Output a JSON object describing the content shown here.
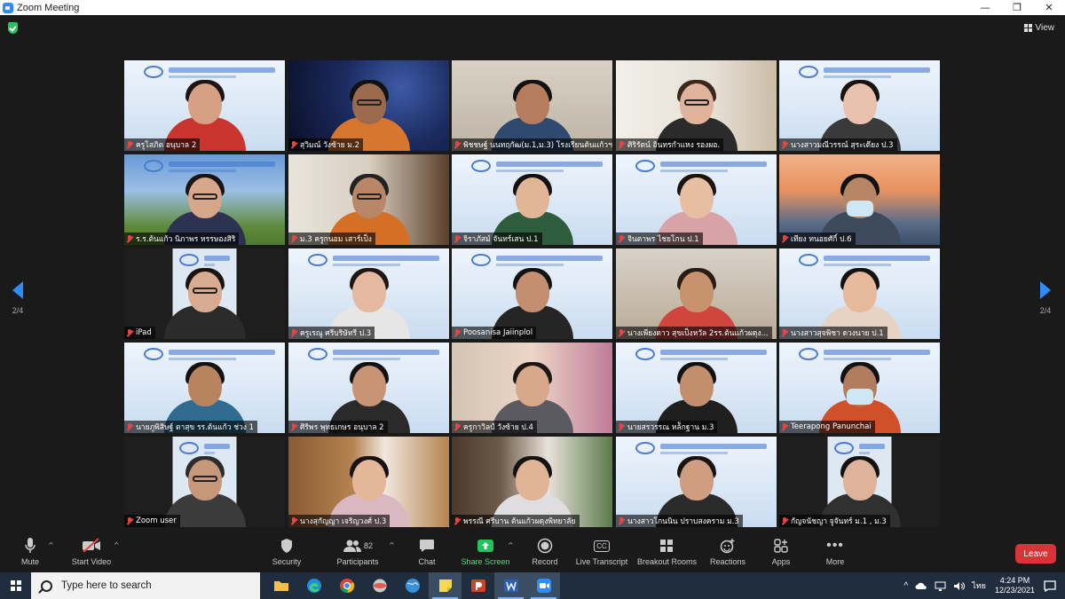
{
  "window": {
    "title": "Zoom Meeting",
    "controls": [
      "minimize",
      "restore",
      "close"
    ]
  },
  "top_right": {
    "view_label": "View"
  },
  "pagination": {
    "left": "2/4",
    "right": "2/4"
  },
  "participants": [
    {
      "name": "ครูโสภิต อนุบาล 2",
      "muted": true,
      "scene": "banner",
      "body": "#c8352f",
      "skin": "#d7a084",
      "hair": "#1b1411"
    },
    {
      "name": "สุวิมณ์ วังซ้าย ม.2",
      "muted": true,
      "scene": "space",
      "body": "#d7772f",
      "skin": "#9b6a4e",
      "hair": "#111",
      "glasses": true
    },
    {
      "name": "พิชชษฐ์ นนทฤกัฒ(ม.1,ม.3) โรงเรียนต้นแก้วฯ",
      "muted": true,
      "scene": "room",
      "body": "#2f4a6e",
      "skin": "#b57d5d",
      "hair": "#111"
    },
    {
      "name": "ศิริรัตน์ อินทรกำแหง รองผอ.",
      "muted": true,
      "scene": "shelf",
      "body": "#2b2b2b",
      "skin": "#e1b39a",
      "hair": "#3b281d",
      "glasses": true
    },
    {
      "name": "นางสาวมณีวรรณ์ สุระเดียง ป.3",
      "muted": true,
      "scene": "banner",
      "body": "#3a3a3a",
      "skin": "#e9c2ad",
      "hair": "#161210"
    },
    {
      "name": "ร.ร.ต้นแก้ว นิภาพร หรรษองสิริ",
      "muted": true,
      "scene": "school",
      "body": "#2c3350",
      "skin": "#d6a78a",
      "hair": "#1a1412",
      "glasses": true
    },
    {
      "name": "ม.3 ครูกนอม เสาร์เป็ง",
      "muted": true,
      "scene": "home",
      "body": "#d46f25",
      "skin": "#b88767",
      "hair": "#222",
      "glasses": true
    },
    {
      "name": "จิราภัสม์ จันทร์เสน ป.1",
      "muted": true,
      "scene": "banner",
      "body": "#2e5d3e",
      "skin": "#e0b697",
      "hair": "#111"
    },
    {
      "name": "จินตาพร ไชยโกน ป.1",
      "muted": true,
      "scene": "banner",
      "body": "#d7a3a7",
      "skin": "#e6bfa3",
      "hair": "#1a1411"
    },
    {
      "name": "เทียง ทนอยศักิ์ ป.6",
      "muted": true,
      "scene": "bridge",
      "body": "#3d4a5c",
      "skin": "#b58566",
      "hair": "#111",
      "mask": true
    },
    {
      "name": "iPad",
      "muted": true,
      "scene": "ipad",
      "body": "#2b2b2b",
      "skin": "#d9ab90",
      "hair": "#181311",
      "glasses": true
    },
    {
      "name": "ครูเรณู ศรีบริษัทรี ป.3",
      "muted": true,
      "scene": "banner",
      "body": "#e6e6e6",
      "skin": "#e4b99f",
      "hair": "#1d1512"
    },
    {
      "name": "Poosanisa Jaiinplol",
      "muted": true,
      "scene": "banner",
      "body": "#252525",
      "skin": "#c48f70",
      "hair": "#111"
    },
    {
      "name": "นางเพียงดาว สุขเป็งหวัล 2รร.ต้นแก้วผดุง...",
      "muted": true,
      "scene": "blur",
      "body": "#d0463e",
      "skin": "#c9926f",
      "hair": "#2a1c14"
    },
    {
      "name": "นางสาวสุจพิชา ดวงนาย ป.1",
      "muted": true,
      "scene": "banner",
      "body": "#e7d3c4",
      "skin": "#e6b99b",
      "hair": "#131010"
    },
    {
      "name": "นายภูพิสิษฐ์ ตาสุข รร.ต้นแก้ว ช่วง 1",
      "muted": true,
      "scene": "banner",
      "body": "#2f6c8f",
      "skin": "#b7845f",
      "hair": "#111"
    },
    {
      "name": "ศิริพร พุทธเกษร อนุบาล 2",
      "muted": true,
      "scene": "banner",
      "body": "#2a2a2a",
      "skin": "#c99476",
      "hair": "#121010"
    },
    {
      "name": "ครูกาวิลป์ วังซ้าย ป.4",
      "muted": true,
      "scene": "warm",
      "body": "#5b5a60",
      "skin": "#d8a88d",
      "hair": "#1c1512"
    },
    {
      "name": "นายสรวรรณ หล้ักฐาน ม.3",
      "muted": true,
      "scene": "banner",
      "body": "#1f1f1f",
      "skin": "#c38e6c",
      "hair": "#111"
    },
    {
      "name": "Teerapong Panunchai",
      "muted": true,
      "scene": "banner",
      "body": "#d0502a",
      "skin": "#b27d5e",
      "hair": "#111",
      "mask": true
    },
    {
      "name": "Zoom user",
      "muted": true,
      "scene": "ipad",
      "body": "#3b3b3b",
      "skin": "#c6977a",
      "hair": "#2c2c2c",
      "glasses": true
    },
    {
      "name": "นางสุกัญญา เจริญวงศ์ ป.3",
      "muted": true,
      "scene": "teddy",
      "body": "#d9b8c2",
      "skin": "#e4b69a",
      "hair": "#15110f"
    },
    {
      "name": "พรรณี ศรีบาน ต้นแก้วผดุงพิทยาลัย",
      "muted": true,
      "scene": "room2",
      "body": "#e0dde0",
      "skin": "#e2b497",
      "hair": "#141010"
    },
    {
      "name": "นางสาวโกนนิน ปราบสงคราม ม.3",
      "muted": true,
      "scene": "banner",
      "body": "#2b2b2b",
      "skin": "#cf9d80",
      "hair": "#1a1411"
    },
    {
      "name": "กัญจนัชญา จูจันทร์ ม.1 , ม.3",
      "muted": true,
      "scene": "ipad",
      "body": "#303030",
      "skin": "#dfb39a",
      "hair": "#141010"
    }
  ],
  "toolbar": {
    "mute": "Mute",
    "start_video": "Start Video",
    "security": "Security",
    "participants": "Participants",
    "participants_count": "82",
    "chat": "Chat",
    "share_screen": "Share Screen",
    "record": "Record",
    "live_transcript": "Live Transcript",
    "breakout_rooms": "Breakout Rooms",
    "reactions": "Reactions",
    "apps": "Apps",
    "more": "More",
    "leave": "Leave",
    "cc": "CC"
  },
  "taskbar": {
    "search_placeholder": "Type here to search",
    "time": "4:24 PM",
    "date": "12/23/2021",
    "lang": "ไทย"
  },
  "colors": {
    "accent": "#2d8cff",
    "leave": "#d7343a",
    "share": "#23c45e",
    "muted": "#e64545"
  }
}
